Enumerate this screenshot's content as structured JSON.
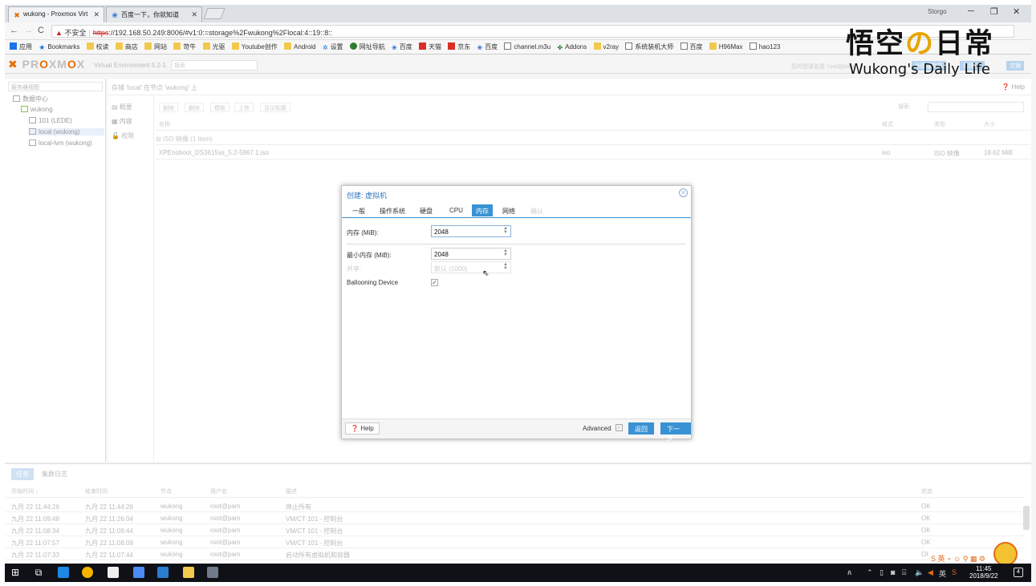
{
  "browser": {
    "tabs": [
      {
        "title": "wukong - Proxmox Virt",
        "icon": "proxmox-icon"
      },
      {
        "title": "百度一下，你就知道",
        "icon": "baidu-icon"
      }
    ],
    "user": "Storgo",
    "url": {
      "security": "不安全",
      "protocol": "https",
      "rest": "://192.168.50.249:8006/#v1:0:=storage%2Fwukong%2Flocal:4::19::8::"
    },
    "bookmarks": [
      {
        "label": "应用",
        "icon": "apps-icon"
      },
      {
        "label": "Bookmarks",
        "icon": "star-icon"
      },
      {
        "label": "校读",
        "icon": "folder-icon"
      },
      {
        "label": "商店",
        "icon": "folder-icon"
      },
      {
        "label": "网站",
        "icon": "folder-icon"
      },
      {
        "label": "苛牛",
        "icon": "folder-icon"
      },
      {
        "label": "光驱",
        "icon": "folder-icon"
      },
      {
        "label": "Youtube创作",
        "icon": "folder-icon"
      },
      {
        "label": "Android",
        "icon": "folder-icon"
      },
      {
        "label": "设置",
        "icon": "gear-icon"
      },
      {
        "label": "网址导航",
        "icon": "globe-icon"
      },
      {
        "label": "百度",
        "icon": "baidu-icon"
      },
      {
        "label": "天猫",
        "icon": "tmall-icon"
      },
      {
        "label": "京东",
        "icon": "jd-icon"
      },
      {
        "label": "百度",
        "icon": "baidu-icon"
      },
      {
        "label": "channel.m3u",
        "icon": "page-icon"
      },
      {
        "label": "Addons",
        "icon": "puzzle-icon"
      },
      {
        "label": "v2ray",
        "icon": "folder-icon"
      },
      {
        "label": "系统装机大师",
        "icon": "page-icon"
      },
      {
        "label": "百度",
        "icon": "page-icon"
      },
      {
        "label": "H96Max",
        "icon": "folder-icon"
      },
      {
        "label": "hao123",
        "icon": "page-icon"
      }
    ]
  },
  "watermark": {
    "title_a": "悟空",
    "title_o": "の",
    "title_b": "日常",
    "subtitle": "Wukong's Daily Life"
  },
  "pve": {
    "version": "Virtual Environment 5.2-1",
    "search_placeholder": "搜索",
    "logged_in": "您的登录名是 'root@pam'",
    "header_buttons": [
      "创建虚拟机",
      "创建CT",
      "注销"
    ],
    "tree_view": "服务器视图",
    "tree": [
      {
        "label": "数据中心",
        "icon": "datacenter-icon"
      },
      {
        "label": "wukong",
        "icon": "server-icon"
      },
      {
        "label": "101 (LEDE)",
        "icon": "vm-icon"
      },
      {
        "label": "local (wukong)",
        "icon": "storage-icon"
      },
      {
        "label": "local-lvm (wukong)",
        "icon": "storage-icon"
      }
    ],
    "content_title": "存储 'local' 在节点 'wukong' 上",
    "help": "Help",
    "side_nav": [
      "概要",
      "内容",
      "权限"
    ],
    "toolbar": [
      "删除",
      "删除",
      "模板",
      "上传",
      "显示配置"
    ],
    "search_label": "搜索:",
    "columns": [
      "名称",
      "格式",
      "类型",
      "大小"
    ],
    "group_header": "ISO 映像 (1 Item)",
    "rows": [
      {
        "name": "XPEnoboot_DS3615xs_5.2-5967.1.iso",
        "format": "iso",
        "type": "ISO 映像",
        "size": "18.62 MiB"
      }
    ],
    "log_tabs": [
      "任务",
      "集群日志"
    ],
    "log_columns": [
      "开始时间 ↓",
      "结束时间",
      "节点",
      "用户名",
      "描述",
      "状态"
    ],
    "log_rows": [
      {
        "start": "九月 22 11:44:26",
        "end": "九月 22 11:44:26",
        "node": "wukong",
        "user": "root@pam",
        "desc": "停止所有",
        "status": "OK"
      },
      {
        "start": "九月 22 11:09:48",
        "end": "九月 22 11:26:04",
        "node": "wukong",
        "user": "root@pam",
        "desc": "VM/CT 101 - 控制台",
        "status": "OK"
      },
      {
        "start": "九月 22 11:08:34",
        "end": "九月 22 11:09:44",
        "node": "wukong",
        "user": "root@pam",
        "desc": "VM/CT 101 - 控制台",
        "status": "OK"
      },
      {
        "start": "九月 22 11:07:57",
        "end": "九月 22 11:08:09",
        "node": "wukong",
        "user": "root@pam",
        "desc": "VM/CT 101 - 控制台",
        "status": "OK"
      },
      {
        "start": "九月 22 11:07:33",
        "end": "九月 22 11:07:44",
        "node": "wukong",
        "user": "root@pam",
        "desc": "启动所有虚拟机和容器",
        "status": "OK"
      }
    ]
  },
  "modal": {
    "title": "创建: 虚拟机",
    "tabs": [
      "一般",
      "操作系统",
      "硬盘",
      "CPU",
      "内存",
      "网络",
      "确认"
    ],
    "active_tab": "内存",
    "memory_label": "内存 (MiB):",
    "memory_value": "2048",
    "min_memory_label": "最小内存 (MiB):",
    "min_memory_value": "2048",
    "shares_label": "共享:",
    "shares_placeholder": "默认 (1000)",
    "ballooning_label": "Ballooning Device",
    "help": "Help",
    "advanced": "Advanced",
    "back": "返回",
    "next": "下一步"
  },
  "taskbar": {
    "time": "11:45",
    "date": "2018/9/22",
    "ime": "英",
    "notifications": "4"
  },
  "colors": {
    "accent": "#3892d4",
    "proxmox_orange": "#e57000",
    "title_blue": "#2f78c2"
  }
}
